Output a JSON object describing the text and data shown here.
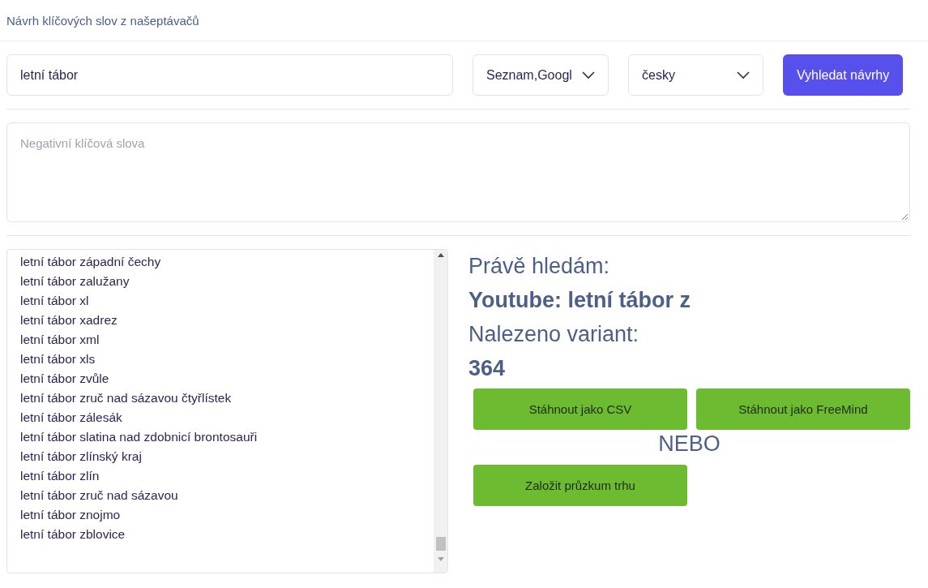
{
  "header": {
    "title": "Návrh klíčových slov z našeptávačů"
  },
  "search": {
    "value": "letní tábor",
    "sources": "Seznam,Googl",
    "language": "česky",
    "button": "Vyhledat návrhy"
  },
  "negative_keywords": {
    "placeholder": "Negativní klíčová slova"
  },
  "results": [
    "letní tábor západní čechy",
    "letní tábor zalužany",
    "letní tábor xl",
    "letní tábor xadrez",
    "letní tábor xml",
    "letní tábor xls",
    "letní tábor zvůle",
    "letní tábor zruč nad sázavou čtyřlístek",
    "letní tábor zálesák",
    "letní tábor slatina nad zdobnicí brontosauři",
    "letní tábor zlínský kraj",
    "letní tábor zlín",
    "letní tábor zruč nad sázavou",
    "letní tábor znojmo",
    "letní tábor zblovice"
  ],
  "status": {
    "searching_label": "Právě hledám:",
    "searching_value": "Youtube: letní tábor z",
    "found_label": "Nalezeno variant:",
    "found_value": "364"
  },
  "actions": {
    "download_buttons": [
      "Stáhnout jako CSV",
      "Stáhnout jako FreeMind"
    ],
    "separator": "NEBO",
    "survey_button": "Založit průzkum trhu"
  }
}
